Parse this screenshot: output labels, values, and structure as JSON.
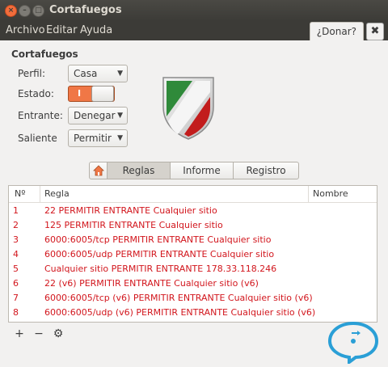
{
  "window": {
    "title": "Cortafuegos"
  },
  "menu": {
    "archivo": "Archivo",
    "editar": "Editar",
    "ayuda": "Ayuda",
    "donar": "¿Donar?"
  },
  "firewall": {
    "section_title": "Cortafuegos",
    "perfil_label": "Perfil:",
    "perfil_value": "Casa",
    "estado_label": "Estado:",
    "estado_on": "I",
    "entrante_label": "Entrante:",
    "entrante_value": "Denegar",
    "saliente_label": "Saliente",
    "saliente_value": "Permitir"
  },
  "tabs": {
    "reglas": "Reglas",
    "informe": "Informe",
    "registro": "Registro",
    "active": "reglas"
  },
  "table": {
    "headers": {
      "num": "Nº",
      "regla": "Regla",
      "nombre": "Nombre"
    },
    "rows": [
      {
        "num": "1",
        "regla": "22 PERMITIR ENTRANTE Cualquier sitio"
      },
      {
        "num": "2",
        "regla": "125 PERMITIR ENTRANTE Cualquier sitio"
      },
      {
        "num": "3",
        "regla": "6000:6005/tcp PERMITIR ENTRANTE Cualquier sitio"
      },
      {
        "num": "4",
        "regla": "6000:6005/udp PERMITIR ENTRANTE Cualquier sitio"
      },
      {
        "num": "5",
        "regla": "Cualquier sitio PERMITIR ENTRANTE 178.33.118.246"
      },
      {
        "num": "6",
        "regla": "22 (v6) PERMITIR ENTRANTE Cualquier sitio (v6)"
      },
      {
        "num": "7",
        "regla": "6000:6005/tcp (v6) PERMITIR ENTRANTE Cualquier sitio (v6)"
      },
      {
        "num": "8",
        "regla": "6000:6005/udp (v6) PERMITIR ENTRANTE Cualquier sitio (v6)"
      }
    ]
  },
  "toolbar": {
    "add": "+",
    "remove": "−",
    "settings_icon": "gear-icon"
  },
  "colors": {
    "accent": "#f07746",
    "rule_text": "#d2161d",
    "titlebar": "#3c3b37"
  }
}
